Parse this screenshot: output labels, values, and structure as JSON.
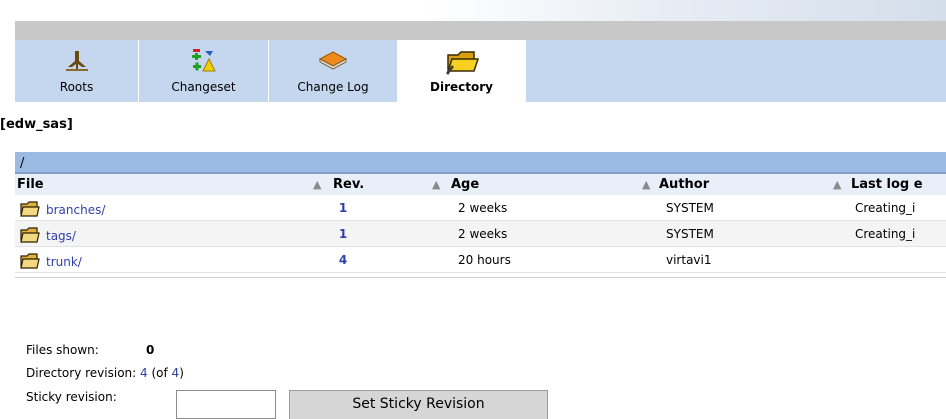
{
  "tabs": [
    {
      "label": "Roots",
      "icon": "tree-icon",
      "active": false
    },
    {
      "label": "Changeset",
      "icon": "changeset-icon",
      "active": false
    },
    {
      "label": "Change Log",
      "icon": "book-icon",
      "active": false
    },
    {
      "label": "Directory",
      "icon": "folder-icon",
      "active": true
    }
  ],
  "repo_name": "[edw_sas]",
  "path": "/",
  "columns": {
    "file": "File",
    "rev": "Rev.",
    "age": "Age",
    "author": "Author",
    "last_log": "Last log e"
  },
  "rows": [
    {
      "file": "branches/",
      "rev": "1",
      "age": "2 weeks",
      "author": "SYSTEM",
      "log": "Creating_i"
    },
    {
      "file": "tags/",
      "rev": "1",
      "age": "2 weeks",
      "author": "SYSTEM",
      "log": "Creating_i"
    },
    {
      "file": "trunk/",
      "rev": "4",
      "age": "20 hours",
      "author": "virtavi1",
      "log": ""
    }
  ],
  "footer": {
    "files_shown_label": "Files shown:",
    "files_shown_value": "0",
    "dir_rev_label": "Directory revision:",
    "dir_rev_value": "4",
    "dir_rev_of_prefix": " (of ",
    "dir_rev_of_value": "4",
    "dir_rev_of_suffix": ")",
    "sticky_label": "Sticky revision:",
    "sticky_input_value": "",
    "sticky_button": "Set Sticky Revision"
  },
  "colors": {
    "tab_bg": "#c4d7ef",
    "path_bar": "#9cbbe4",
    "link": "#2f3fa8"
  }
}
